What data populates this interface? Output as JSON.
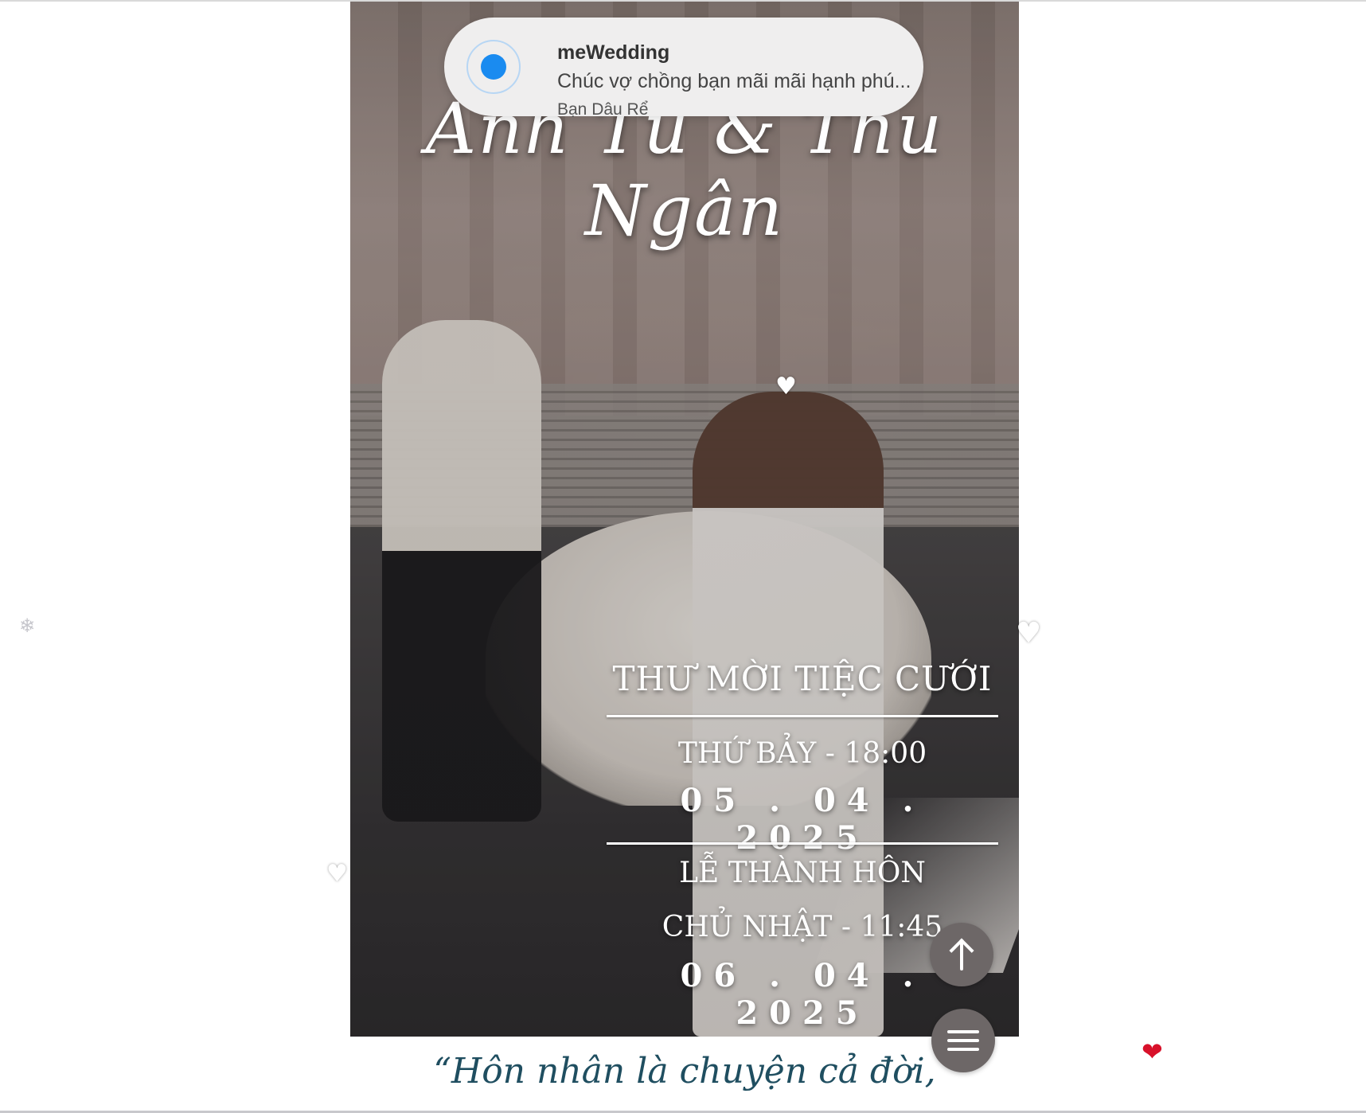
{
  "notification": {
    "app_name": "meWedding",
    "message": "Chúc vợ chồng bạn mãi mãi hạnh phú...",
    "sender": "Bạn Dâu Rể",
    "accent_color": "#1a8bf0"
  },
  "hero": {
    "couple_names": "Anh Tú & Thu Ngân"
  },
  "invitation": {
    "title": "THƯ MỜI TIỆC CƯỚI",
    "party_day_time": "THỨ BẢY - 18:00",
    "party_date": "05 . 04 . 2025",
    "ceremony_label": "LỄ THÀNH HÔN",
    "ceremony_day_time": "CHỦ NHẬT - 11:45",
    "ceremony_date": "06 . 04 . 2025"
  },
  "controls": {
    "scroll_top_icon": "arrow-up-icon",
    "menu_icon": "hamburger-menu-icon",
    "button_color": "#6d6767"
  },
  "decorations": {
    "heart_white": "♥",
    "heart_red": "❤",
    "snowflake": "❄"
  },
  "quote": {
    "text": "“Hôn nhân là chuyện cả đời,"
  }
}
